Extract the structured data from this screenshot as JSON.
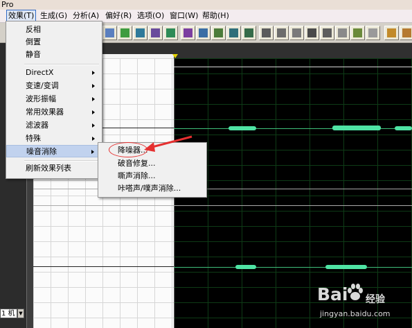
{
  "window": {
    "title_fragment": "Pro"
  },
  "menubar": {
    "items": [
      {
        "label": "效果(T)",
        "active": true
      },
      {
        "label": "生成(G)"
      },
      {
        "label": "分析(A)"
      },
      {
        "label": "偏好(R)"
      },
      {
        "label": "选项(O)"
      },
      {
        "label": "窗口(W)"
      },
      {
        "label": "帮助(H)"
      }
    ]
  },
  "effects_menu": {
    "items": [
      {
        "label": "反相"
      },
      {
        "label": "倒置"
      },
      {
        "label": "静音"
      },
      {
        "label": "DirectX",
        "submenu": true
      },
      {
        "label": "变速/变调",
        "submenu": true
      },
      {
        "label": "波形振幅",
        "submenu": true
      },
      {
        "label": "常用效果器",
        "submenu": true
      },
      {
        "label": "滤波器",
        "submenu": true
      },
      {
        "label": "特殊",
        "submenu": true
      },
      {
        "label": "噪音消除",
        "submenu": true,
        "highlighted": true
      },
      {
        "label": "刷新效果列表"
      }
    ]
  },
  "noise_submenu": {
    "items": [
      {
        "label": "降噪器..."
      },
      {
        "label": "破音修复..."
      },
      {
        "label": "嘶声消除..."
      },
      {
        "label": "咔嗒声/噗声消除..."
      }
    ]
  },
  "zoom": {
    "value": "1 机"
  },
  "watermark": {
    "logo": "Bai",
    "logo_cn": "经验",
    "url": "jingyan.baidu.com"
  },
  "colors": {
    "waveform": "#4fe3a4",
    "annotation": "#e53030",
    "menu_highlight": "#c1d2ee"
  }
}
